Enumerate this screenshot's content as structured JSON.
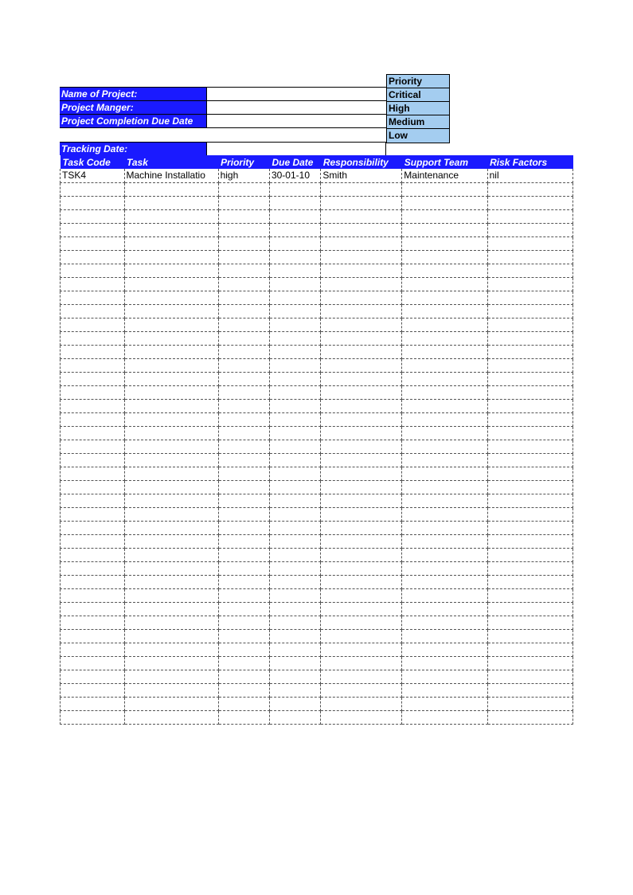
{
  "info": {
    "rows": [
      {
        "label": "Name of Project:",
        "value": ""
      },
      {
        "label": "Project Manger:",
        "value": ""
      },
      {
        "label": "Project Completion Due Date",
        "value": ""
      }
    ]
  },
  "priority_box": {
    "header": "Priority",
    "levels": [
      "Critical",
      "High",
      "Medium",
      "Low"
    ]
  },
  "tracking": {
    "label": "Tracking Date:",
    "value": ""
  },
  "table": {
    "headers": [
      "Task Code",
      "Task",
      "Priority",
      "Due Date",
      "Responsibility",
      "Support Team",
      "Risk Factors"
    ],
    "rows": [
      {
        "task_code": "TSK4",
        "task": "Machine Installatio",
        "priority": "high",
        "due_date": "30-01-10",
        "responsibility": "Smith",
        "support_team": "Maintenance",
        "risk_factors": "nil"
      }
    ],
    "empty_rows": 40
  }
}
